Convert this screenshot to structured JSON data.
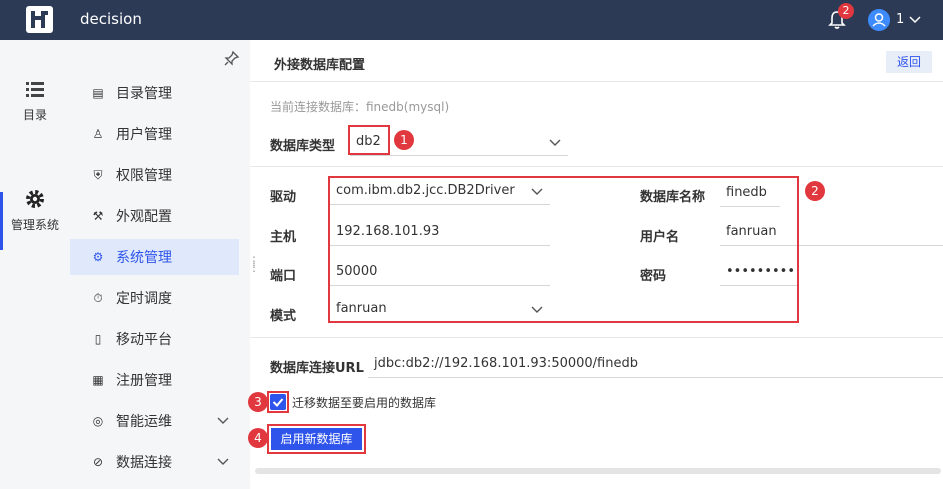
{
  "app": {
    "title": "decision",
    "notifications_count": "2",
    "user_name": "1"
  },
  "rail": [
    {
      "label": "目录",
      "icon": "list-icon"
    },
    {
      "label": "管理系统",
      "icon": "gear-icon"
    }
  ],
  "nav": {
    "items": [
      {
        "label": "目录管理",
        "icon": "folder-icon"
      },
      {
        "label": "用户管理",
        "icon": "user-icon"
      },
      {
        "label": "权限管理",
        "icon": "shield-icon"
      },
      {
        "label": "外观配置",
        "icon": "paint-icon"
      },
      {
        "label": "系统管理",
        "icon": "settings-icon"
      },
      {
        "label": "定时调度",
        "icon": "timer-icon"
      },
      {
        "label": "移动平台",
        "icon": "mobile-icon"
      },
      {
        "label": "注册管理",
        "icon": "register-icon"
      },
      {
        "label": "智能运维",
        "icon": "ops-icon"
      },
      {
        "label": "数据连接",
        "icon": "link-icon"
      }
    ]
  },
  "main": {
    "title": "外接数据库配置",
    "back_label": "返回",
    "current_db_hint": "当前连接数据库：finedb(mysql)",
    "db_type_label": "数据库类型",
    "db_type_value": "db2",
    "driver_label": "驱动",
    "driver_value": "com.ibm.db2.jcc.DB2Driver",
    "db_name_label": "数据库名称",
    "db_name_value": "finedb",
    "host_label": "主机",
    "host_value": "192.168.101.93",
    "user_label": "用户名",
    "user_value": "fanruan",
    "port_label": "端口",
    "port_value": "50000",
    "password_label": "密码",
    "password_value": "•••••••••",
    "schema_label": "模式",
    "schema_value": "fanruan",
    "url_label": "数据库连接URL",
    "url_value": "jdbc:db2://192.168.101.93:50000/finedb",
    "migrate_label": "迁移数据至要启用的数据库",
    "migrate_checked": true,
    "enable_button": "启用新数据库"
  },
  "markers": [
    "1",
    "2",
    "3",
    "4"
  ],
  "colors": {
    "topbar": "#2c3a55",
    "accent": "#2f54eb",
    "highlight": "#e0383e"
  }
}
